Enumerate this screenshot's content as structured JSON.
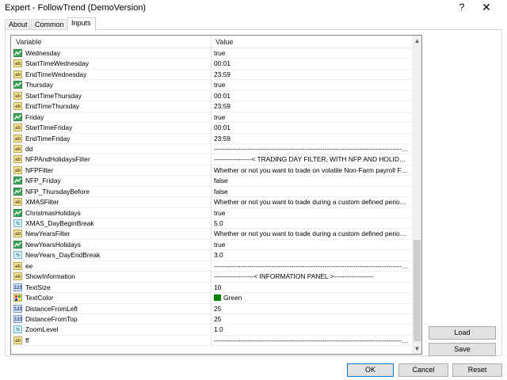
{
  "window": {
    "title": "Expert - FollowTrend (DemoVersion)",
    "help_label": "?",
    "close_label": "✕"
  },
  "tabs": [
    {
      "label": "About"
    },
    {
      "label": "Common"
    },
    {
      "label": "Inputs"
    }
  ],
  "grid": {
    "columns": {
      "variable": "Variable",
      "value": "Value"
    },
    "rows": [
      {
        "icon": "bool",
        "icon_text": "",
        "name": "Wednesday",
        "value": "true"
      },
      {
        "icon": "str",
        "icon_text": "ab",
        "name": "StartTimeWednesday",
        "value": "00:01"
      },
      {
        "icon": "str",
        "icon_text": "ab",
        "name": "EndTimeWednesday",
        "value": "23:59"
      },
      {
        "icon": "bool",
        "icon_text": "",
        "name": "Thursday",
        "value": "true"
      },
      {
        "icon": "str",
        "icon_text": "ab",
        "name": "StartTimeThursday",
        "value": "00:01"
      },
      {
        "icon": "str",
        "icon_text": "ab",
        "name": "EndTimeThursday",
        "value": "23:59"
      },
      {
        "icon": "bool",
        "icon_text": "",
        "name": "Friday",
        "value": "true"
      },
      {
        "icon": "str",
        "icon_text": "ab",
        "name": "StartTimeFriday",
        "value": "00:01"
      },
      {
        "icon": "str",
        "icon_text": "ab",
        "name": "EndTimeFriday",
        "value": "23:59"
      },
      {
        "icon": "str",
        "icon_text": "ab",
        "name": "dd",
        "value": "------------------------------------------------------------------------------------------------"
      },
      {
        "icon": "str",
        "icon_text": "ab",
        "name": "NFPAndHolidaysFilter",
        "value": "-----------------< TRADING DAY FILTER, WITH NFP AND HOLIDAYS >-----------------"
      },
      {
        "icon": "str",
        "icon_text": "ab",
        "name": "NFPFilter",
        "value": "Whether or not you want to trade on volatile Non-Farm payroll Fridays"
      },
      {
        "icon": "bool",
        "icon_text": "",
        "name": "NFP_Friday",
        "value": "false"
      },
      {
        "icon": "bool",
        "icon_text": "",
        "name": "NFP_ThursdayBefore",
        "value": "false"
      },
      {
        "icon": "str",
        "icon_text": "ab",
        "name": "XMASFilter",
        "value": "Whether or not you want to trade during a custom defined period in December"
      },
      {
        "icon": "bool",
        "icon_text": "",
        "name": "ChristmasHolidays",
        "value": "true"
      },
      {
        "icon": "dbl",
        "icon_text": "½",
        "name": "XMAS_DayBeginBreak",
        "value": "5.0"
      },
      {
        "icon": "str",
        "icon_text": "ab",
        "name": "NewYearsFilter",
        "value": "Whether or not you want to trade during a custom defined period in January"
      },
      {
        "icon": "bool",
        "icon_text": "",
        "name": "NewYearsHolidays",
        "value": "true"
      },
      {
        "icon": "dbl",
        "icon_text": "½",
        "name": "NewYears_DayEndBreak",
        "value": "3.0"
      },
      {
        "icon": "str",
        "icon_text": "ab",
        "name": "ee",
        "value": "------------------------------------------------------------------------------------------------"
      },
      {
        "icon": "str",
        "icon_text": "ab",
        "name": "ShowInformation",
        "value": "------------------< INFORMATION PANEL >------------------"
      },
      {
        "icon": "int",
        "icon_text": "123",
        "name": "TextSize",
        "value": "10"
      },
      {
        "icon": "clr",
        "icon_text": "",
        "name": "TextColor",
        "value": "Green",
        "swatch": "#008000"
      },
      {
        "icon": "int",
        "icon_text": "123",
        "name": "DistanceFromLeft",
        "value": "25"
      },
      {
        "icon": "int",
        "icon_text": "123",
        "name": "DistanceFromTop",
        "value": "25"
      },
      {
        "icon": "dbl",
        "icon_text": "½",
        "name": "ZoomLevel",
        "value": "1.0"
      },
      {
        "icon": "str",
        "icon_text": "ab",
        "name": "ff",
        "value": "------------------------------------------------------------------------------------------------"
      }
    ]
  },
  "buttons": {
    "load": "Load",
    "save": "Save",
    "ok": "OK",
    "cancel": "Cancel",
    "reset": "Reset"
  },
  "colors": {
    "ok_border": "#0078d7",
    "bool_icon": "#3fa75a",
    "string_icon": "#f4e6a2",
    "text_color_swatch": "#008000"
  }
}
